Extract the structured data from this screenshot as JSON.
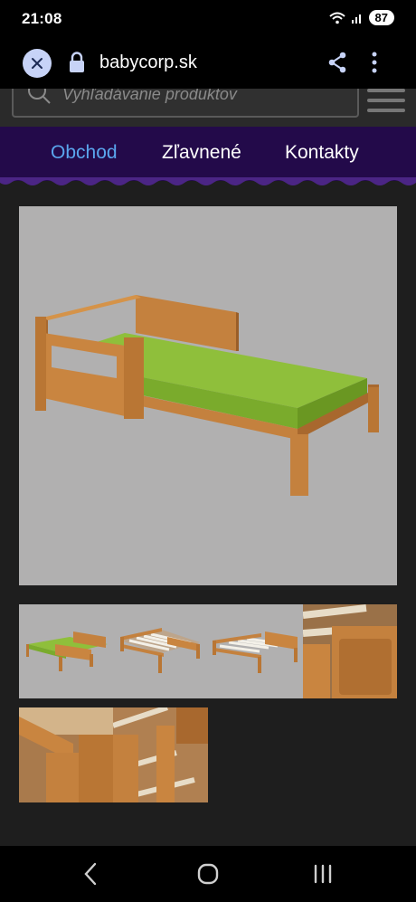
{
  "status_bar": {
    "time": "21:08",
    "battery": "87"
  },
  "browser": {
    "url": "babycorp.sk"
  },
  "search": {
    "placeholder": "Vyhľadávanie produktov"
  },
  "nav": {
    "items": [
      {
        "label": "Obchod",
        "active": true
      },
      {
        "label": "Zľavnené",
        "active": false
      },
      {
        "label": "Kontakty",
        "active": false
      }
    ]
  },
  "colors": {
    "nav_background": "#230a4a",
    "nav_active": "#5aa6ee",
    "wood": "#c4813e",
    "mattress": "#8fbf3b",
    "image_background": "#b1b0b0"
  },
  "icons": [
    "close-icon",
    "lock-icon",
    "share-icon",
    "more-vert-icon",
    "search-icon",
    "menu-icon",
    "back-icon",
    "home-icon",
    "recents-icon",
    "wifi-icon",
    "signal-icon"
  ]
}
